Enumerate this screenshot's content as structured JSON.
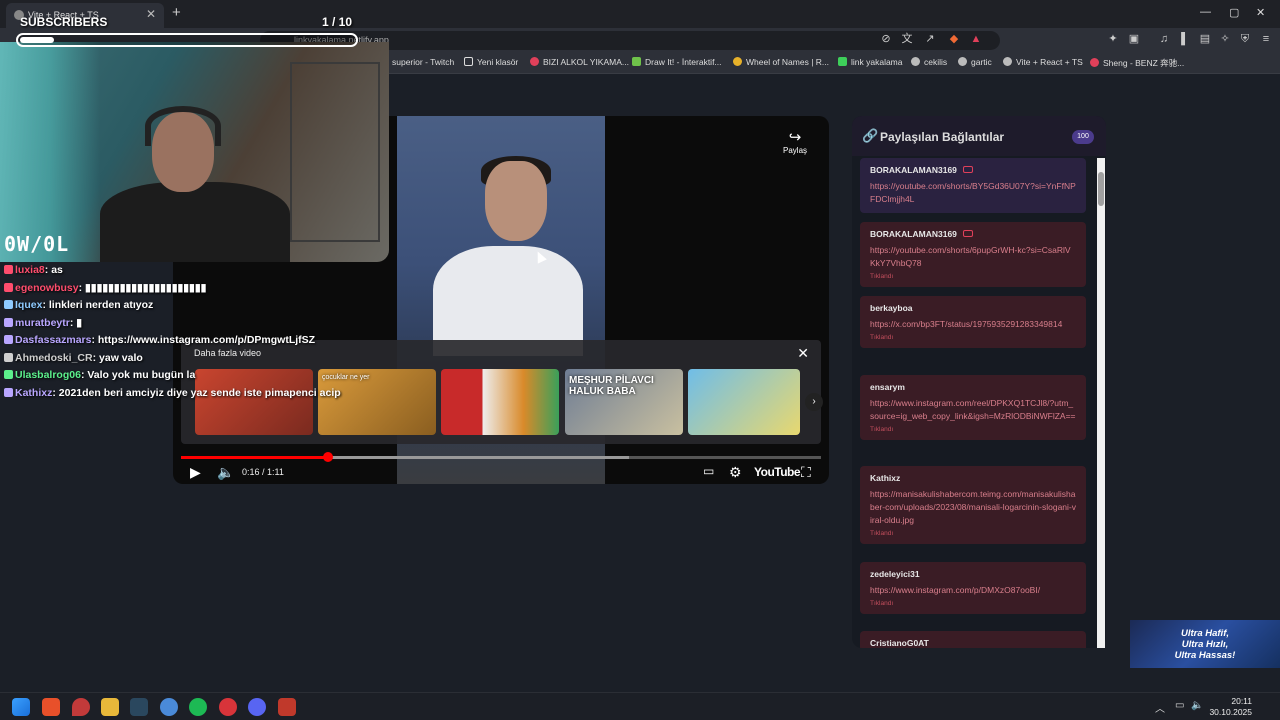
{
  "browser": {
    "tab_title": "Vite + React + TS",
    "url": "linkyakalama.netlify.app",
    "bookmarks": [
      {
        "label": "superior - Twitch",
        "color": "#9146ff"
      },
      {
        "label": "Yeni klasör",
        "color": "#dddddd"
      },
      {
        "label": "BIZI ALKOL YIKAMA...",
        "color": "#e0405a"
      },
      {
        "label": "Draw It! - İnteraktif...",
        "color": "#6fc24a"
      },
      {
        "label": "Wheel of Names | R...",
        "color": "#e7b12a"
      },
      {
        "label": "link yakalama",
        "color": "#3ecf5a"
      },
      {
        "label": "cekilis",
        "color": "#bbbbbb"
      },
      {
        "label": "gartic",
        "color": "#bbbbbb"
      },
      {
        "label": "Vite + React + TS",
        "color": "#bbbbbb"
      },
      {
        "label": "Sheng - BENZ 奔驰...",
        "color": "#e0405a"
      }
    ]
  },
  "stream_overlay": {
    "subs_label": "SUBSCRIBERS",
    "subs_count": "1  / 10",
    "subs_progress": 0.1,
    "cam_logo": "0W/0L",
    "chat": [
      {
        "user": "luxia8",
        "text": "as",
        "color": "#ff4d6d"
      },
      {
        "user": "egenowbusy",
        "text": "▮▮▮▮▮▮▮▮▮▮▮▮▮▮▮▮▮▮▮▮▮",
        "color": "#ff4d6d"
      },
      {
        "user": "Iquex",
        "text": "linkleri nerden atıyoz",
        "color": "#8ecbff"
      },
      {
        "user": "muratbeytr",
        "text": "▮",
        "color": "#b9a6ff"
      },
      {
        "user": "Dasfassazmars",
        "text": "https://www.instagram.com/p/DPmgwtLjfSZ",
        "color": "#b9a6ff"
      },
      {
        "user": "Ahmedoski_CR",
        "text": "yaw valo",
        "color": "#cfcfcf"
      },
      {
        "user": "Ulasbalrog06",
        "text": "Valo yok mu bugün la",
        "color": "#5cf08c"
      },
      {
        "user": "Kathixz",
        "text": "2021den beri amciyiz diye yaz sende iste pimapenci acip",
        "color": "#b9a6ff"
      }
    ]
  },
  "player": {
    "share_label": "Paylaş",
    "more_videos_label": "Daha fazla video",
    "thumbs": [
      {
        "label": "",
        "color": "#c9452f"
      },
      {
        "label": "çocuklar ne yer",
        "color": "#d99a3b"
      },
      {
        "label": "",
        "color": "#c82a2a"
      },
      {
        "label": "MEŞHUR PİLAVCI HALUK BABA",
        "color": "#6f7d94"
      },
      {
        "label": "",
        "color": "#6fbde8"
      }
    ],
    "time": "0:16 / 1:11",
    "played_fraction": 0.23,
    "buffered_fraction": 0.7,
    "brand": "YouTube"
  },
  "links_panel": {
    "title": "Paylaşılan Bağlantılar",
    "count": "100",
    "items": [
      {
        "user": "BORAKALAMAN3169",
        "url": "https://youtube.com/shorts/BY5Gd36U07Y?si=YnFfNPFDClmjjh4L",
        "status": "",
        "youtube": true,
        "style": "purple"
      },
      {
        "user": "BORAKALAMAN3169",
        "url": "https://youtube.com/shorts/6pupGrWH-kc?si=CsaRlVKkY7VhbQ78",
        "status": "Tıklandı",
        "youtube": true,
        "style": "red"
      },
      {
        "user": "berkayboa",
        "url": "https://x.com/bp3FT/status/1975935291283349814",
        "status": "Tıklandı",
        "youtube": false,
        "style": "red"
      },
      {
        "user": "ensarym",
        "url": "https://www.instagram.com/reel/DPKXQ1TCJl8/?utm_source=ig_web_copy_link&igsh=MzRlODBiNWFlZA==",
        "status": "Tıklandı",
        "youtube": false,
        "style": "red"
      },
      {
        "user": "Kathixz",
        "url": "https://manisakulishabercom.teimg.com/manisakulishaber-com/uploads/2023/08/manisali-logarcinin-slogani-viral-oldu.jpg",
        "status": "Tıklandı",
        "youtube": false,
        "style": "red"
      },
      {
        "user": "zedeleyici31",
        "url": "https://www.instagram.com/p/DMXzO87ooBI/",
        "status": "Tıklandı",
        "youtube": false,
        "style": "red"
      },
      {
        "user": "CristianoG0AT",
        "url": "",
        "status": "",
        "youtube": false,
        "style": "red"
      }
    ]
  },
  "ad": {
    "line1": "Ultra Hafif,",
    "line2": "Ultra Hızlı,",
    "line3": "Ultra Hassas!"
  },
  "taskbar": {
    "time": "20:11",
    "date": "30.10.2025"
  }
}
